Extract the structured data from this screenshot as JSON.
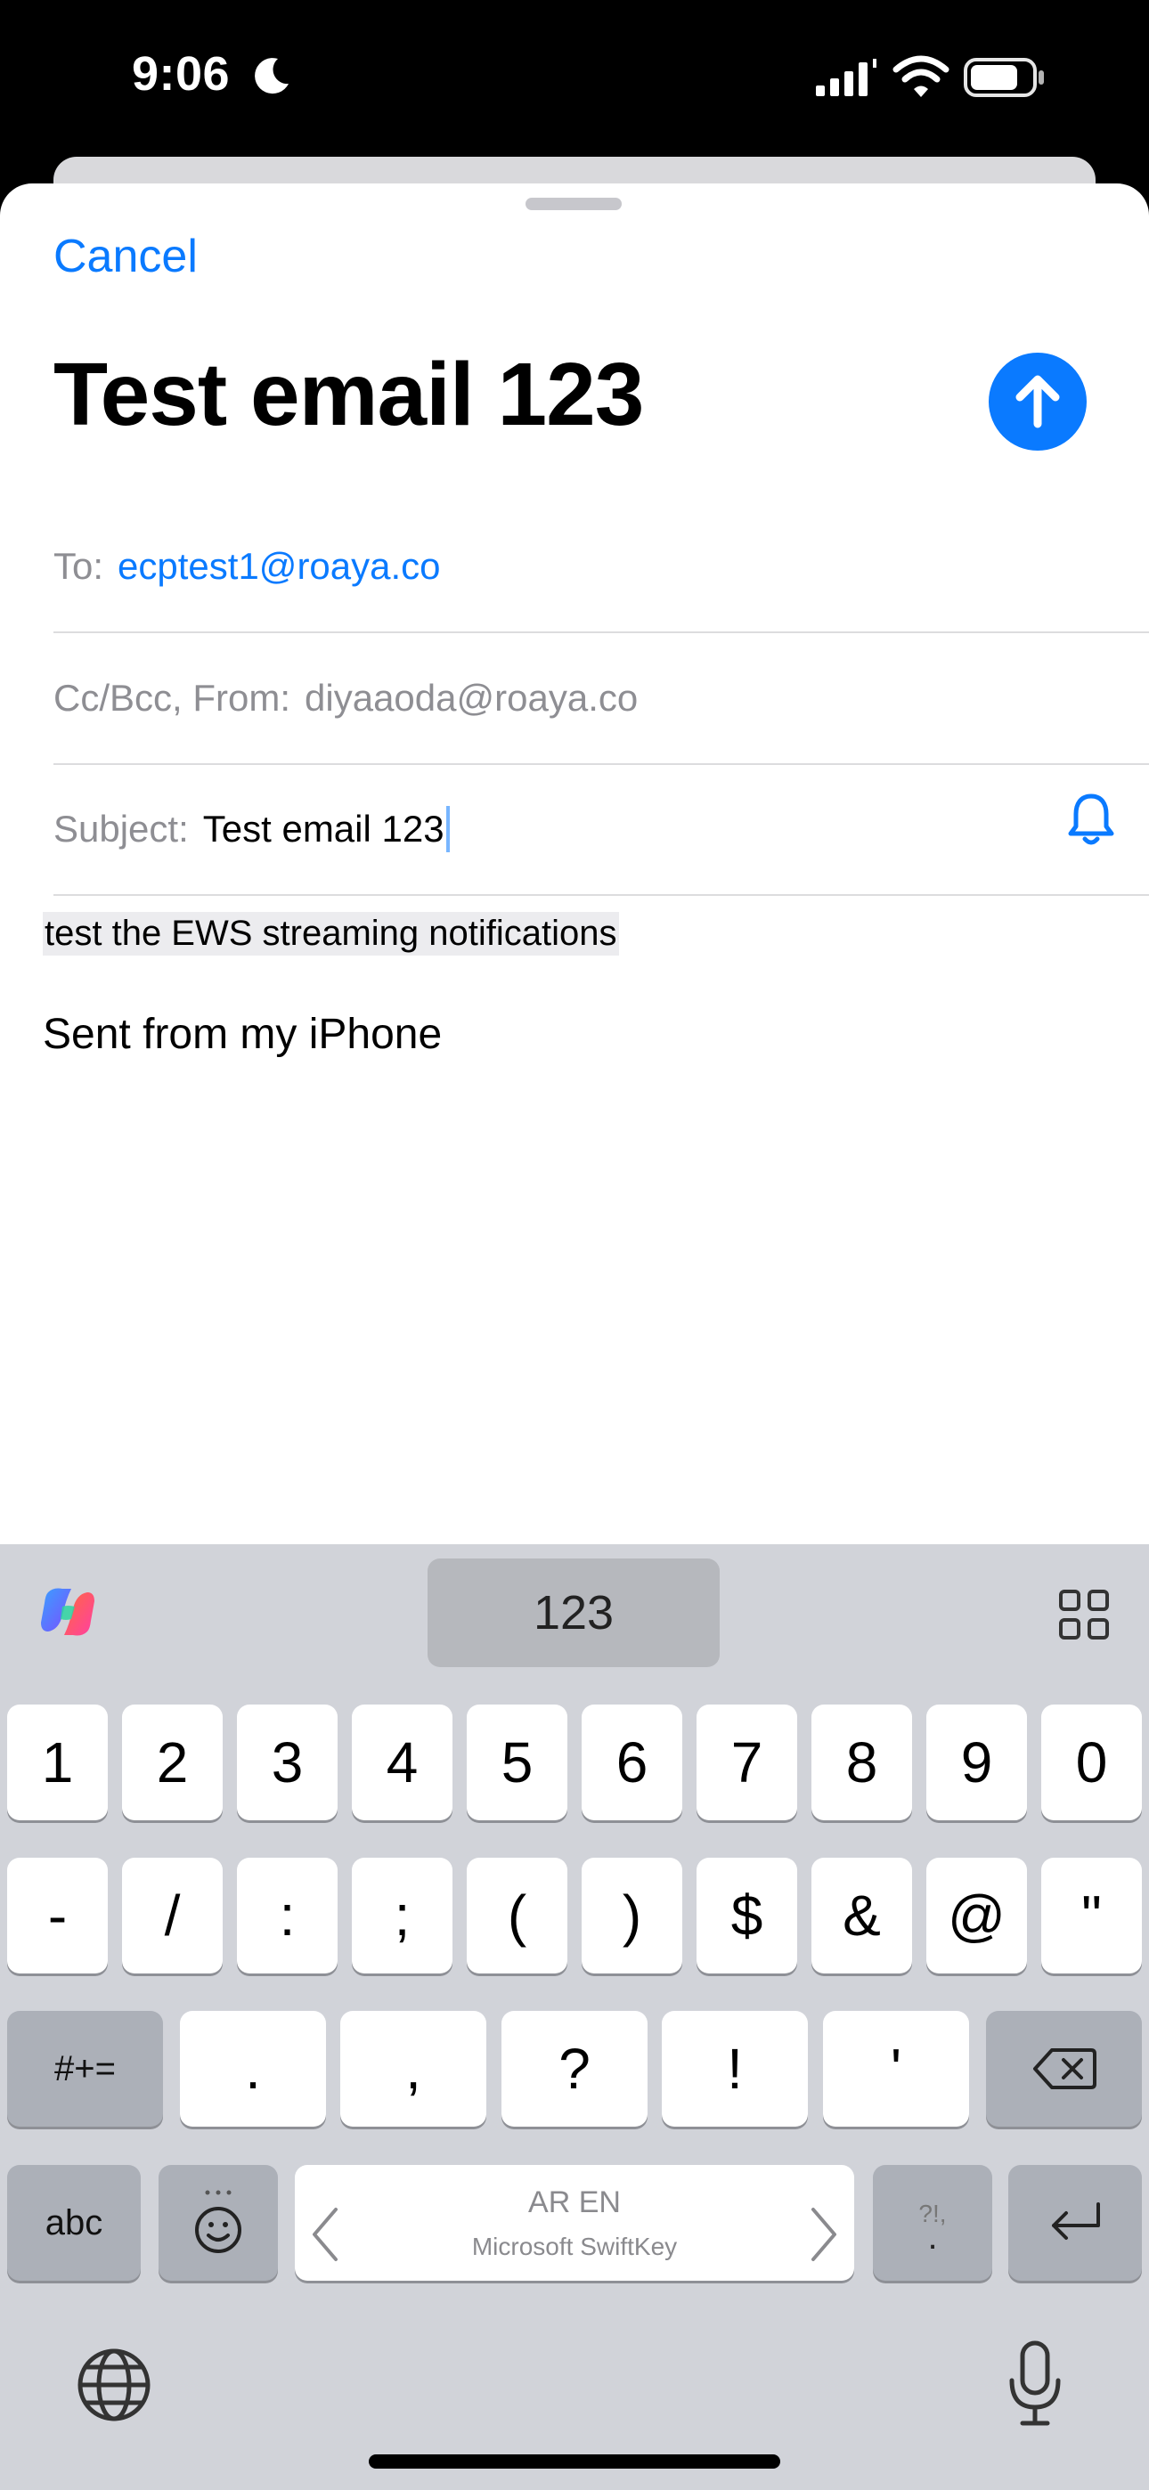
{
  "status_bar": {
    "time": "9:06"
  },
  "compose": {
    "cancel_label": "Cancel",
    "title": "Test email 123",
    "to_label": "To:",
    "to_value": "ecptest1@roaya.co",
    "ccbcc_label": "Cc/Bcc, From:",
    "from_value": "diyaaoda@roaya.co",
    "subject_label": "Subject:",
    "subject_value": "Test email 123",
    "body_text": "test the EWS streaming notifications",
    "signature": "Sent from my iPhone"
  },
  "keyboard": {
    "toolbar_label": "123",
    "row1": [
      "1",
      "2",
      "3",
      "4",
      "5",
      "6",
      "7",
      "8",
      "9",
      "0"
    ],
    "row2": [
      "-",
      "/",
      ":",
      ";",
      "(",
      ")",
      "$",
      "&",
      "@",
      "\""
    ],
    "row3_mode": "#+=",
    "row3": [
      ".",
      ",",
      "?",
      "!",
      "'"
    ],
    "row4_abc": "abc",
    "space_langs": "AR EN",
    "space_brand": "Microsoft SwiftKey",
    "punct_top": "?!,",
    "punct_bottom": "."
  },
  "colors": {
    "accent": "#0a7aff",
    "keyboard_bg": "#d1d3d9",
    "key_fn": "#acb0b8"
  }
}
